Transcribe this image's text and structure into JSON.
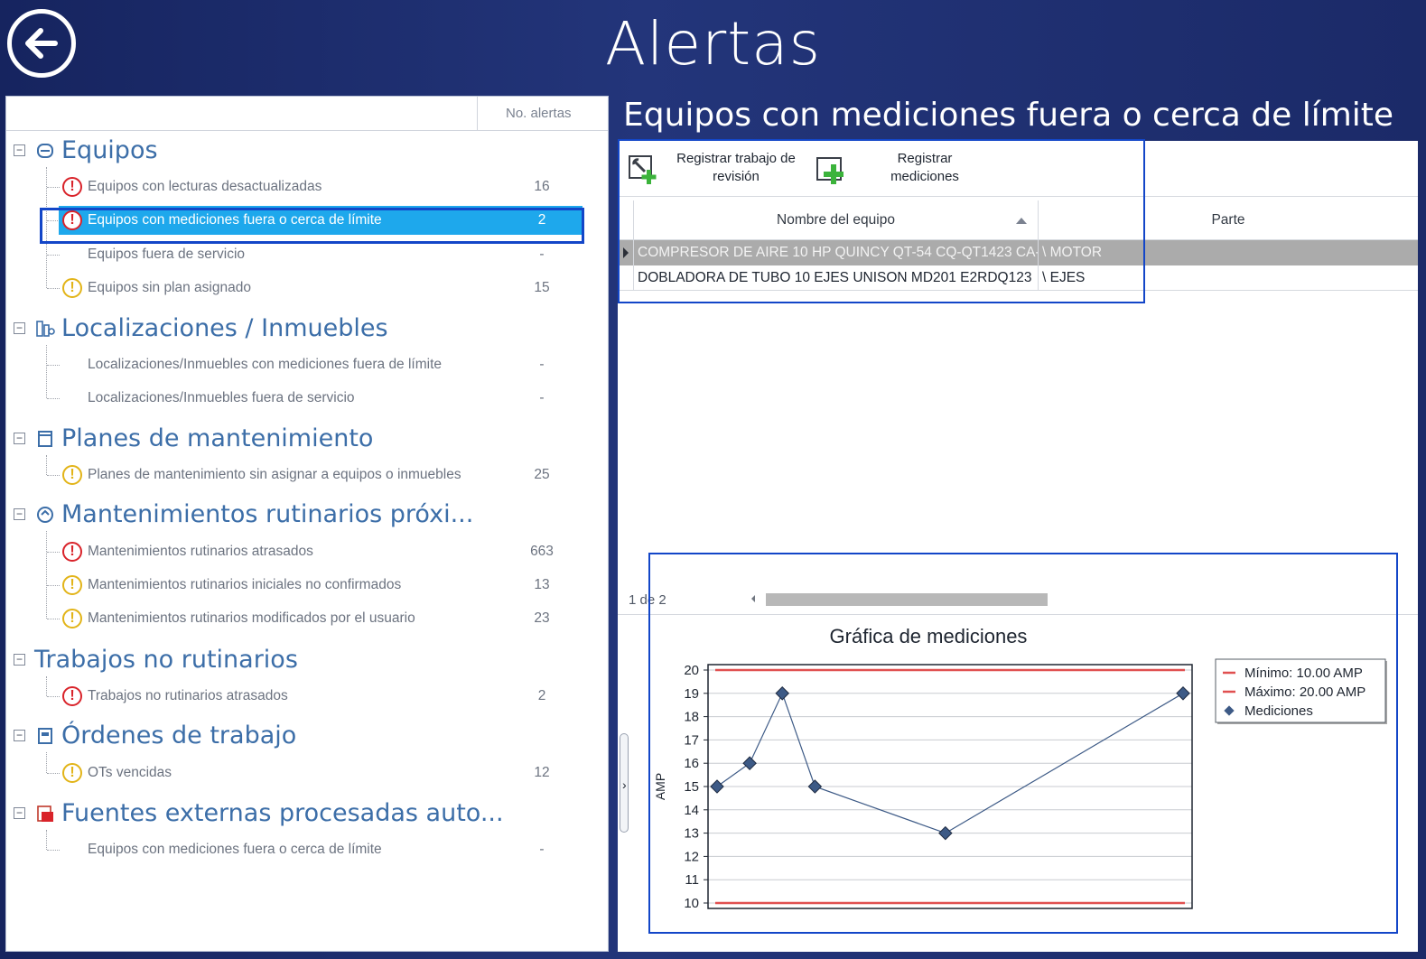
{
  "app": {
    "title": "Alertas"
  },
  "left_panel": {
    "column_header": "No. alertas",
    "categories": [
      {
        "label": "Equipos",
        "icon": "gear-box-icon",
        "items": [
          {
            "label": "Equipos con lecturas desactualizadas",
            "count": "16",
            "icon": "red"
          },
          {
            "label": "Equipos con mediciones fuera o cerca de límite",
            "count": "2",
            "icon": "red",
            "selected": true
          },
          {
            "label": "Equipos fuera de servicio",
            "count": "-",
            "icon": "none"
          },
          {
            "label": "Equipos sin plan asignado",
            "count": "15",
            "icon": "yellow"
          }
        ]
      },
      {
        "label": "Localizaciones / Inmuebles",
        "icon": "buildings-icon",
        "items": [
          {
            "label": "Localizaciones/Inmuebles con mediciones fuera de límite",
            "count": "-",
            "icon": "none"
          },
          {
            "label": "Localizaciones/Inmuebles fuera de servicio",
            "count": "-",
            "icon": "none"
          }
        ]
      },
      {
        "label": "Planes de mantenimiento",
        "icon": "calendar-icon",
        "items": [
          {
            "label": "Planes de mantenimiento sin asignar a equipos o inmuebles",
            "count": "25",
            "icon": "yellow"
          }
        ]
      },
      {
        "label": "Mantenimientos rutinarios próxi...",
        "icon": "routine-icon",
        "items": [
          {
            "label": "Mantenimientos rutinarios atrasados",
            "count": "663",
            "icon": "red"
          },
          {
            "label": "Mantenimientos rutinarios iniciales no confirmados",
            "count": "13",
            "icon": "yellow"
          },
          {
            "label": "Mantenimientos rutinarios modificados por el usuario",
            "count": "23",
            "icon": "yellow"
          }
        ]
      },
      {
        "label": "Trabajos no rutinarios",
        "icon": "none",
        "items": [
          {
            "label": "Trabajos no rutinarios atrasados",
            "count": "2",
            "icon": "red"
          }
        ]
      },
      {
        "label": "Órdenes de trabajo",
        "icon": "work-order-icon",
        "items": [
          {
            "label": "OTs vencidas",
            "count": "12",
            "icon": "yellow"
          }
        ]
      },
      {
        "label": "Fuentes externas procesadas auto...",
        "icon": "pdf-source-icon",
        "items": [
          {
            "label": "Equipos con mediciones fuera o cerca de límite",
            "count": "-",
            "icon": "none"
          }
        ]
      }
    ]
  },
  "right_panel": {
    "title": "Equipos con mediciones fuera o cerca de límite",
    "toolbar": {
      "review_label": "Registrar trabajo de\nrevisión",
      "measure_label": "Registrar\nmediciones"
    },
    "grid": {
      "columns": [
        "Nombre del equipo",
        "Parte"
      ],
      "rows": [
        {
          "name": "COMPRESOR DE AIRE 10 HP QUINCY QT-54 CQ-QT1423 CA-",
          "part": "\\ MOTOR",
          "current": true
        },
        {
          "name": "DOBLADORA DE TUBO 10 EJES UNISON MD201 E2RDQ123",
          "part": "\\ EJES",
          "current": false
        }
      ],
      "pager": "1 de 2"
    }
  },
  "chart_data": {
    "type": "line",
    "title": "Gráfica de mediciones",
    "ylabel": "AMP",
    "xlabel": "",
    "ylim": [
      10,
      20
    ],
    "yticks": [
      10,
      11,
      12,
      13,
      14,
      15,
      16,
      17,
      18,
      19,
      20
    ],
    "grid": true,
    "legend_position": "top-right",
    "series": [
      {
        "name": "Mínimo: 10.00 AMP",
        "kind": "threshold",
        "value": 10,
        "color": "#e05050"
      },
      {
        "name": "Máximo: 20.00 AMP",
        "kind": "threshold",
        "value": 20,
        "color": "#e05050"
      },
      {
        "name": "Mediciones",
        "kind": "line",
        "color": "#3d5a86",
        "x": [
          0,
          0.07,
          0.14,
          0.21,
          0.49,
          1.0
        ],
        "values": [
          15,
          16,
          19,
          15,
          13,
          19
        ]
      }
    ]
  },
  "colors": {
    "accent": "#1ea8ec",
    "highlight_border": "#1346c8",
    "category_text": "#3c6ea8"
  }
}
